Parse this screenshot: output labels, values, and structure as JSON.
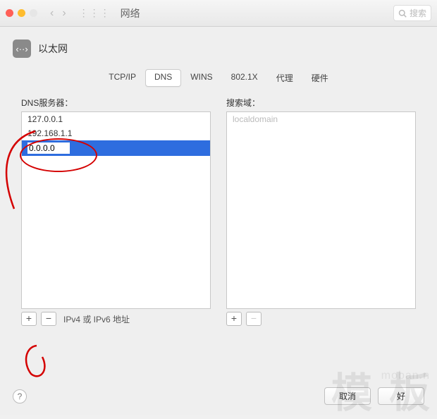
{
  "titlebar": {
    "title": "网络",
    "search_placeholder": "搜索"
  },
  "header": {
    "interface": "以太网"
  },
  "tabs": [
    "TCP/IP",
    "DNS",
    "WINS",
    "802.1X",
    "代理",
    "硬件"
  ],
  "active_tab": "DNS",
  "dns": {
    "label": "DNS服务器：",
    "entries": [
      "127.0.0.1",
      "192.168.1.1"
    ],
    "editing_value": "0.0.0.0",
    "hint": "IPv4 或 IPv6 地址"
  },
  "search_domains": {
    "label": "搜索域：",
    "placeholder": "localdomain"
  },
  "buttons": {
    "add": "+",
    "remove": "−",
    "help": "?",
    "cancel": "取消",
    "ok": "好"
  },
  "watermark": "模 板",
  "watermark2": "moban.n"
}
